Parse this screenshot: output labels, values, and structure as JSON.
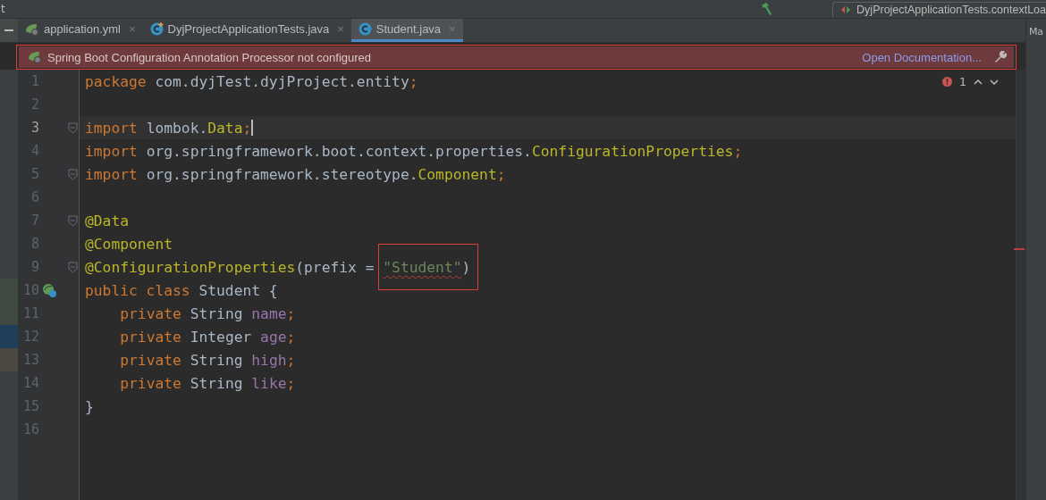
{
  "top_bar": {
    "left_text": "t",
    "run_config": "DyjProjectApplicationTests.contextLoa"
  },
  "tabs": [
    {
      "label": "application.yml",
      "close": "×",
      "selected": false
    },
    {
      "label": "DyjProjectApplicationTests.java",
      "close": "×",
      "selected": false
    },
    {
      "label": "Student.java",
      "close": "×",
      "selected": true
    }
  ],
  "right_strip": {
    "label": "Ma"
  },
  "banner": {
    "text": "Spring Boot Configuration Annotation Processor not configured",
    "link": "Open Documentation...",
    "outlined": true
  },
  "inspection": {
    "count": "1"
  },
  "lines": [
    {
      "number": "1",
      "current": false,
      "fold": false,
      "gutter_icon": false,
      "tokens": [
        {
          "kind": "keyword",
          "text": "package "
        },
        {
          "kind": "plain",
          "text": "com.dyjTest.dyjProject.entity"
        },
        {
          "kind": "keyword",
          "text": ";"
        }
      ]
    },
    {
      "number": "2",
      "current": false,
      "fold": false,
      "gutter_icon": false
    },
    {
      "number": "3",
      "current": true,
      "fold": true,
      "gutter_icon": false,
      "tokens": [
        {
          "kind": "keyword",
          "text": "import "
        },
        {
          "kind": "plain",
          "text": "lombok."
        },
        {
          "kind": "annotation",
          "text": "Data"
        },
        {
          "kind": "keyword",
          "text": ";"
        }
      ]
    },
    {
      "number": "4",
      "current": false,
      "fold": false,
      "gutter_icon": false,
      "tokens": [
        {
          "kind": "keyword",
          "text": "import "
        },
        {
          "kind": "plain",
          "text": "org.springframework.boot.context.properties."
        },
        {
          "kind": "annotation",
          "text": "ConfigurationProperties"
        },
        {
          "kind": "keyword",
          "text": ";"
        }
      ]
    },
    {
      "number": "5",
      "current": false,
      "fold": true,
      "gutter_icon": false,
      "tokens": [
        {
          "kind": "keyword",
          "text": "import "
        },
        {
          "kind": "plain",
          "text": "org.springframework.stereotype."
        },
        {
          "kind": "annotation",
          "text": "Component"
        },
        {
          "kind": "keyword",
          "text": ";"
        }
      ]
    },
    {
      "number": "6",
      "current": false,
      "fold": false,
      "gutter_icon": false
    },
    {
      "number": "7",
      "current": false,
      "fold": true,
      "gutter_icon": false,
      "tokens": [
        {
          "kind": "annotation",
          "text": "@Data"
        }
      ]
    },
    {
      "number": "8",
      "current": false,
      "fold": false,
      "gutter_icon": false,
      "tokens": [
        {
          "kind": "annotation",
          "text": "@Component"
        }
      ]
    },
    {
      "number": "9",
      "current": false,
      "fold": true,
      "gutter_icon": false,
      "tokens": [
        {
          "kind": "annotation",
          "text": "@ConfigurationProperties"
        },
        {
          "kind": "plain",
          "text": "(prefix = "
        },
        {
          "kind": "string",
          "text": "\"Student\"",
          "squiggle": true,
          "outlined": true
        },
        {
          "kind": "plain",
          "text": ")"
        }
      ]
    },
    {
      "number": "10",
      "current": false,
      "fold": false,
      "gutter_icon": true,
      "tokens": [
        {
          "kind": "keyword",
          "text": "public class "
        },
        {
          "kind": "plain",
          "text": "Student {"
        }
      ]
    },
    {
      "number": "11",
      "current": false,
      "fold": false,
      "gutter_icon": false,
      "indented": true,
      "tokens": [
        {
          "kind": "keyword",
          "text": "private "
        },
        {
          "kind": "plain",
          "text": "String "
        },
        {
          "kind": "field",
          "text": "name"
        },
        {
          "kind": "keyword",
          "text": ";"
        }
      ]
    },
    {
      "number": "12",
      "current": false,
      "fold": false,
      "gutter_icon": false,
      "indented": true,
      "tokens": [
        {
          "kind": "keyword",
          "text": "private "
        },
        {
          "kind": "plain",
          "text": "Integer "
        },
        {
          "kind": "field",
          "text": "age"
        },
        {
          "kind": "keyword",
          "text": ";"
        }
      ]
    },
    {
      "number": "13",
      "current": false,
      "fold": false,
      "gutter_icon": false,
      "indented": true,
      "tokens": [
        {
          "kind": "keyword",
          "text": "private "
        },
        {
          "kind": "plain",
          "text": "String "
        },
        {
          "kind": "field",
          "text": "high"
        },
        {
          "kind": "keyword",
          "text": ";"
        }
      ]
    },
    {
      "number": "14",
      "current": false,
      "fold": false,
      "gutter_icon": false,
      "indented": true,
      "tokens": [
        {
          "kind": "keyword",
          "text": "private "
        },
        {
          "kind": "plain",
          "text": "String "
        },
        {
          "kind": "field",
          "text": "like"
        },
        {
          "kind": "keyword",
          "text": ";"
        }
      ]
    },
    {
      "number": "15",
      "current": false,
      "fold": false,
      "gutter_icon": false,
      "tokens": [
        {
          "kind": "plain",
          "text": "}"
        }
      ]
    },
    {
      "number": "16",
      "current": false,
      "fold": false,
      "gutter_icon": false
    }
  ]
}
